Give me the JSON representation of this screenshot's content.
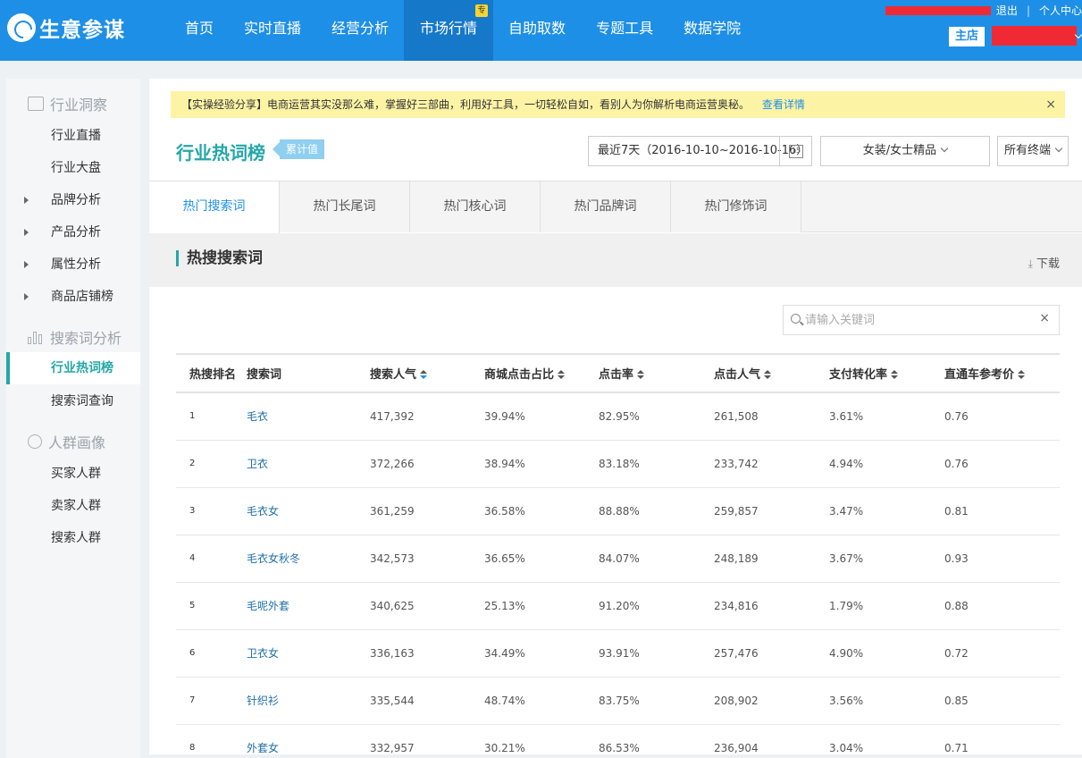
{
  "brand": {
    "name": "生意参谋"
  },
  "nav": [
    {
      "label": "首页"
    },
    {
      "label": "实时直播"
    },
    {
      "label": "经营分析"
    },
    {
      "label": "市场行情",
      "badge": "专"
    },
    {
      "label": "自助取数"
    },
    {
      "label": "专题工具"
    },
    {
      "label": "数据学院"
    }
  ],
  "account": {
    "logout": "退出",
    "center": "个人中心",
    "shop_tag": "主店"
  },
  "sidebar": {
    "sections": [
      {
        "title": "行业洞察",
        "icon": "trend-icon"
      },
      {
        "title": "搜索词分析",
        "icon": "bar-chart-icon"
      },
      {
        "title": "人群画像",
        "icon": "people-icon"
      }
    ],
    "items": [
      {
        "label": "行业直播"
      },
      {
        "label": "行业大盘"
      },
      {
        "label": "品牌分析"
      },
      {
        "label": "产品分析"
      },
      {
        "label": "属性分析"
      },
      {
        "label": "商品店铺榜"
      },
      {
        "label": "行业热词榜"
      },
      {
        "label": "搜索词查询"
      },
      {
        "label": "买家人群"
      },
      {
        "label": "卖家人群"
      },
      {
        "label": "搜索人群"
      }
    ]
  },
  "notice": {
    "text": "【实操经验分享】电商运营其实没那么难，掌握好三部曲，利用好工具，一切轻松自如，看别人为你解析电商运营奥秘。",
    "link": "查看详情",
    "close": "×"
  },
  "page": {
    "title": "行业热词榜",
    "tag": "累计值",
    "date_range": "最近7天（2016-10-10~2016-10-16）",
    "calendar_day": "15",
    "category": "女装/女士精品",
    "terminal": "所有终端"
  },
  "tabs": [
    {
      "label": "热门搜索词"
    },
    {
      "label": "热门长尾词"
    },
    {
      "label": "热门核心词"
    },
    {
      "label": "热门品牌词"
    },
    {
      "label": "热门修饰词"
    }
  ],
  "section": {
    "title": "热搜搜索词",
    "download": "下载"
  },
  "search": {
    "placeholder": "请输入关键词",
    "clear": "×"
  },
  "table": {
    "headers": [
      "热搜排名",
      "搜索词",
      "搜索人气",
      "商城点击占比",
      "点击率",
      "点击人气",
      "支付转化率",
      "直通车参考价"
    ],
    "rows": [
      [
        "1",
        "毛衣",
        "417,392",
        "39.94%",
        "82.95%",
        "261,508",
        "3.61%",
        "0.76"
      ],
      [
        "2",
        "卫衣",
        "372,266",
        "38.94%",
        "83.18%",
        "233,742",
        "4.94%",
        "0.76"
      ],
      [
        "3",
        "毛衣女",
        "361,259",
        "36.58%",
        "88.88%",
        "259,857",
        "3.47%",
        "0.81"
      ],
      [
        "4",
        "毛衣女秋冬",
        "342,573",
        "36.65%",
        "84.07%",
        "248,189",
        "3.67%",
        "0.93"
      ],
      [
        "5",
        "毛呢外套",
        "340,625",
        "25.13%",
        "91.20%",
        "234,816",
        "1.79%",
        "0.88"
      ],
      [
        "6",
        "卫衣女",
        "336,163",
        "34.49%",
        "93.91%",
        "257,476",
        "4.90%",
        "0.72"
      ],
      [
        "7",
        "针织衫",
        "335,544",
        "48.74%",
        "83.75%",
        "208,902",
        "3.56%",
        "0.85"
      ],
      [
        "8",
        "外套女",
        "332,957",
        "30.21%",
        "86.53%",
        "236,904",
        "3.04%",
        "0.71"
      ]
    ]
  },
  "colors": {
    "topbar": "#1e8fe6",
    "accent": "#24a7a8",
    "link": "#1f6fa8",
    "redaction": "#f02a35"
  }
}
